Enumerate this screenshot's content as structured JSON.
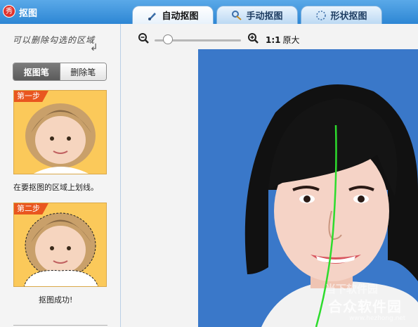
{
  "app": {
    "title": "抠图",
    "logo": "秀"
  },
  "tabs": [
    {
      "label": "自动抠图",
      "icon": "brush-icon",
      "active": true
    },
    {
      "label": "手动抠图",
      "icon": "gear-brush-icon",
      "active": false
    },
    {
      "label": "形状抠图",
      "icon": "shape-icon",
      "active": false
    }
  ],
  "left": {
    "hint": "可以删除勾选的区域",
    "modes": {
      "draw": "抠图笔",
      "erase": "删除笔"
    },
    "steps": [
      {
        "badge": "第一步",
        "caption": "在要抠图的区域上划线。"
      },
      {
        "badge": "第二步",
        "caption": "抠图成功!"
      }
    ]
  },
  "toolbar": {
    "ratio": "1:1",
    "ratio_label": "原大",
    "zoom_level": 0.1
  },
  "watermark": {
    "top": "当下软件园",
    "main": "合众软件园",
    "url": "www.hezhong.net"
  },
  "colors": {
    "accent": "#2d86d4",
    "canvas_bg": "#3a78c9",
    "stroke": "#2ddc2d",
    "badge": "#e9561f"
  }
}
